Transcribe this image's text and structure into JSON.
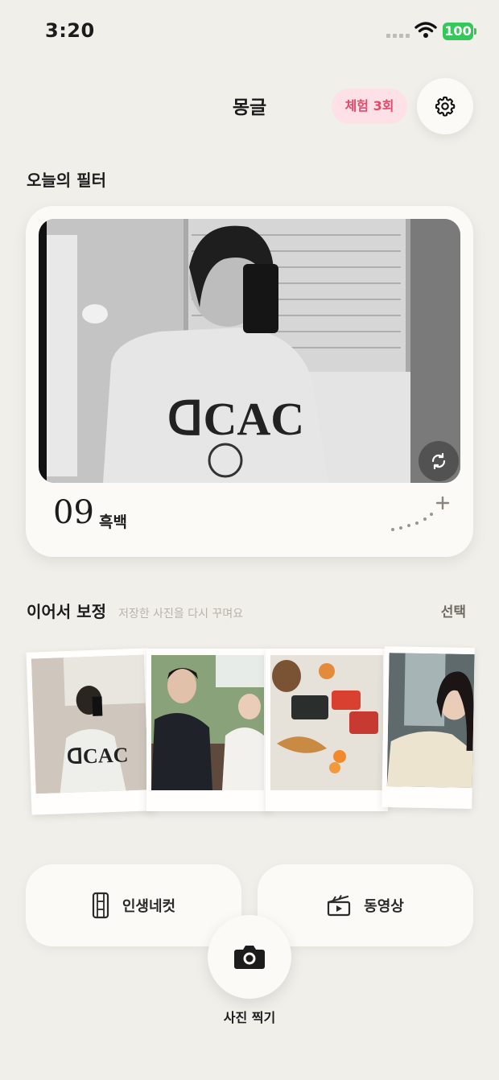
{
  "status_bar": {
    "time": "3:20",
    "battery": "100"
  },
  "header": {
    "title": "몽글",
    "trial_badge": "체험 3회"
  },
  "today_filter": {
    "section_title": "오늘의 필터",
    "number": "09",
    "name": "흑백"
  },
  "continue_edit": {
    "title": "이어서 보정",
    "subtitle": "저장한 사진을 다시 꾸며요",
    "select_label": "선택"
  },
  "actions": {
    "four_cut_label": "인생네컷",
    "video_label": "동영상",
    "camera_label": "사진 찍기"
  },
  "colors": {
    "background": "#f1efea",
    "card": "#fbfaf6",
    "badge_bg": "#fde1e6",
    "badge_text": "#e24b6b",
    "battery": "#34c759"
  },
  "icons": [
    "gear-icon",
    "refresh-icon",
    "plus-icon",
    "film-strip-icon",
    "clapperboard-icon",
    "camera-icon",
    "wifi-icon"
  ]
}
